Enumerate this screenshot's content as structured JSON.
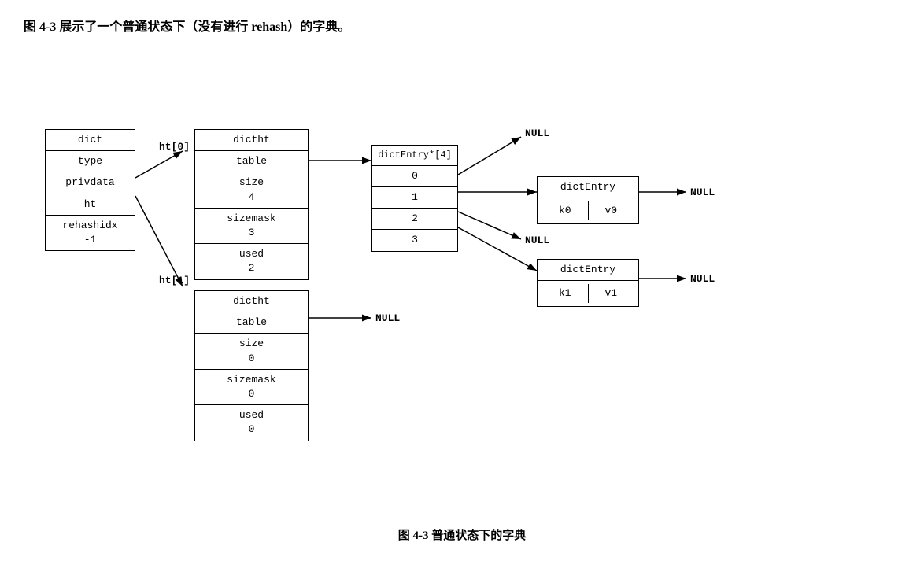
{
  "page": {
    "intro_text": "图 4-3 展示了一个普通状态下（没有进行 rehash）的字典。",
    "caption": "图 4-3   普通状态下的字典"
  },
  "dict_box": {
    "label": "dict",
    "cells": [
      "dict",
      "type",
      "privdata",
      "ht",
      "rehashidx\n-1"
    ]
  },
  "ht0_label": "ht[0]",
  "ht1_label": "ht[1]",
  "dictht0": {
    "label": "dictht",
    "cells": [
      "dictht",
      "table",
      "size\n4",
      "sizemask\n3",
      "used\n2"
    ]
  },
  "dictht1": {
    "label": "dictht",
    "cells": [
      "dictht",
      "table",
      "size\n0",
      "sizemask\n0",
      "used\n0"
    ]
  },
  "dictentry_array": {
    "label": "dictEntry*[4]",
    "cells": [
      "dictEntry*[4]",
      "0",
      "1",
      "2",
      "3"
    ]
  },
  "null_top": "NULL",
  "null_ht1_table": "NULL",
  "null_entry0": "NULL",
  "null_entry1_right": "NULL",
  "null_entry3_right": "NULL",
  "dictentry0": {
    "label": "dictEntry",
    "key": "k0",
    "val": "v0"
  },
  "dictentry3": {
    "label": "dictEntry",
    "key": "k1",
    "val": "v1"
  },
  "null_entry3_below": "NULL"
}
